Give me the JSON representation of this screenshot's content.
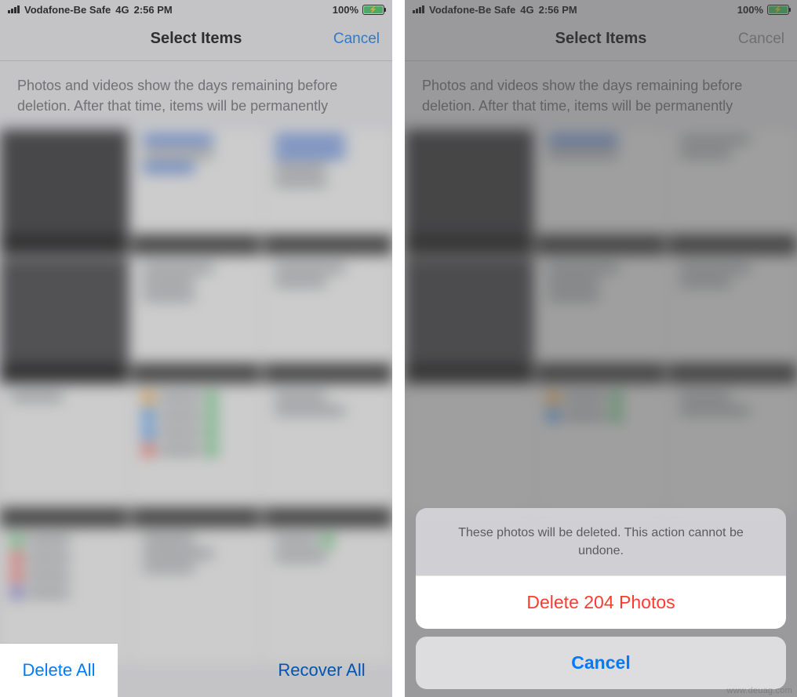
{
  "status": {
    "carrier": "Vodafone-Be Safe",
    "network": "4G",
    "time": "2:56 PM",
    "battery_pct": "100%"
  },
  "left": {
    "nav_title": "Select Items",
    "nav_cancel": "Cancel",
    "desc": "Photos and videos show the days remaining before deletion. After that time, items will be permanently",
    "delete_all": "Delete All",
    "recover_all": "Recover All"
  },
  "right": {
    "nav_title": "Select Items",
    "nav_cancel": "Cancel",
    "desc": "Photos and videos show the days remaining before deletion. After that time, items will be permanently",
    "sheet_msg": "These photos will be deleted. This action cannot be undone.",
    "sheet_delete": "Delete 204 Photos",
    "sheet_cancel": "Cancel"
  },
  "watermark": "www.deuag.com"
}
